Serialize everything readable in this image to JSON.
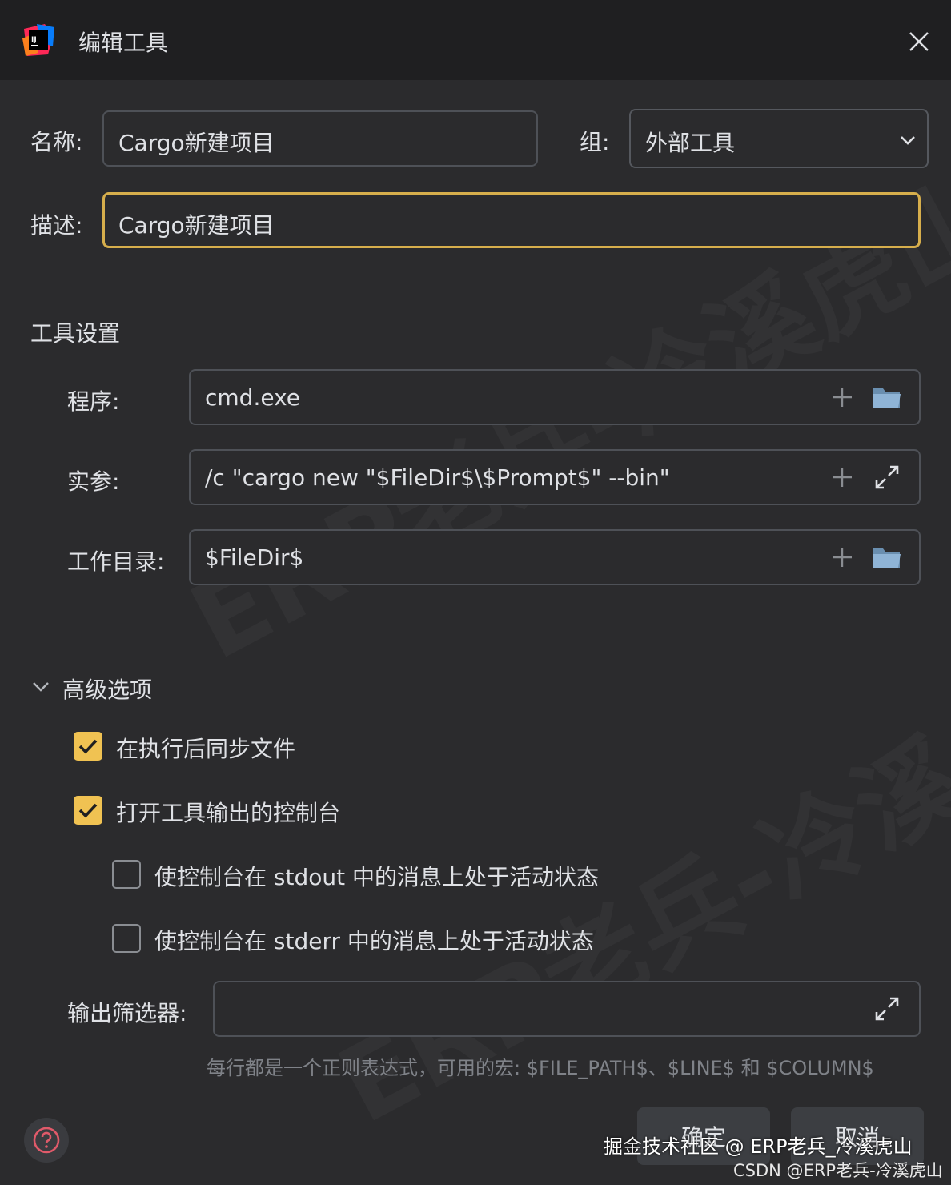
{
  "window": {
    "title": "编辑工具"
  },
  "form": {
    "name_label": "名称:",
    "name_value": "Cargo新建项目",
    "group_label": "组:",
    "group_value": "外部工具",
    "description_label": "描述:",
    "description_value": "Cargo新建项目"
  },
  "tool_settings": {
    "title": "工具设置",
    "program_label": "程序:",
    "program_value": "cmd.exe",
    "arguments_label": "实参:",
    "arguments_value": "/c \"cargo new \"$FileDir$\\$Prompt$\" --bin\"",
    "workdir_label": "工作目录:",
    "workdir_value": "$FileDir$"
  },
  "advanced": {
    "title": "高级选项",
    "options": [
      {
        "label": "在执行后同步文件",
        "checked": true
      },
      {
        "label": "打开工具输出的控制台",
        "checked": true
      },
      {
        "label": "使控制台在 stdout 中的消息上处于活动状态",
        "checked": false
      },
      {
        "label": "使控制台在 stderr 中的消息上处于活动状态",
        "checked": false
      }
    ],
    "output_filter_label": "输出筛选器:",
    "output_filter_value": "",
    "hint": "每行都是一个正则表达式，可用的宏: $FILE_PATH$、$LINE$ 和 $COLUMN$"
  },
  "buttons": {
    "ok": "确定",
    "cancel": "取消"
  },
  "watermarks": {
    "juejin": "掘金技术社区 @ ERP老兵_冷溪虎山",
    "csdn": "CSDN @ERP老兵-冷溪虎山",
    "diagonal_1": "ERP老兵-冷溪虎山",
    "diagonal_2": "ERP老兵-冷溪"
  },
  "colors": {
    "accent": "#f0c252",
    "focus_border": "#d6ae4c",
    "background": "#2b2b2d",
    "titlebar": "#1f1f21",
    "field_border": "#4e5157"
  },
  "icons": {
    "app": "intellij-icon",
    "close": "close-icon",
    "add": "plus-icon",
    "browse": "folder-icon",
    "expand": "expand-icon",
    "dropdown": "chevron-down-icon",
    "collapse": "chevron-down-icon",
    "help": "question-icon"
  }
}
